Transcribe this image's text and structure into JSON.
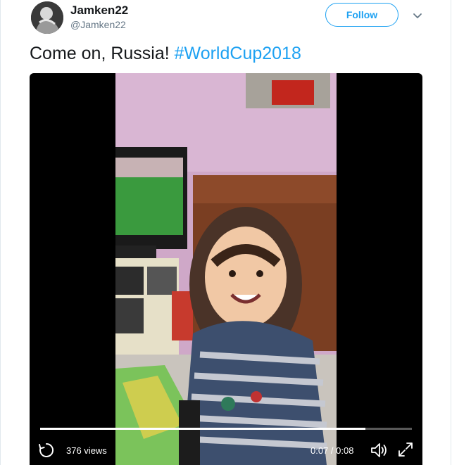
{
  "tweet": {
    "display_name": "Jamken22",
    "handle": "@Jamken22",
    "follow_label": "Follow",
    "text": "Come on, Russia!",
    "hashtag": "#WorldCup2018"
  },
  "video": {
    "views": "376 views",
    "time": "0:07 / 0:08",
    "progress": 0.875
  },
  "colors": {
    "accent": "#1da1f2",
    "text": "#14171a",
    "muted": "#657786"
  },
  "icons": [
    "avatar",
    "chevron-down-icon",
    "replay-icon",
    "volume-icon",
    "fullscreen-icon"
  ]
}
